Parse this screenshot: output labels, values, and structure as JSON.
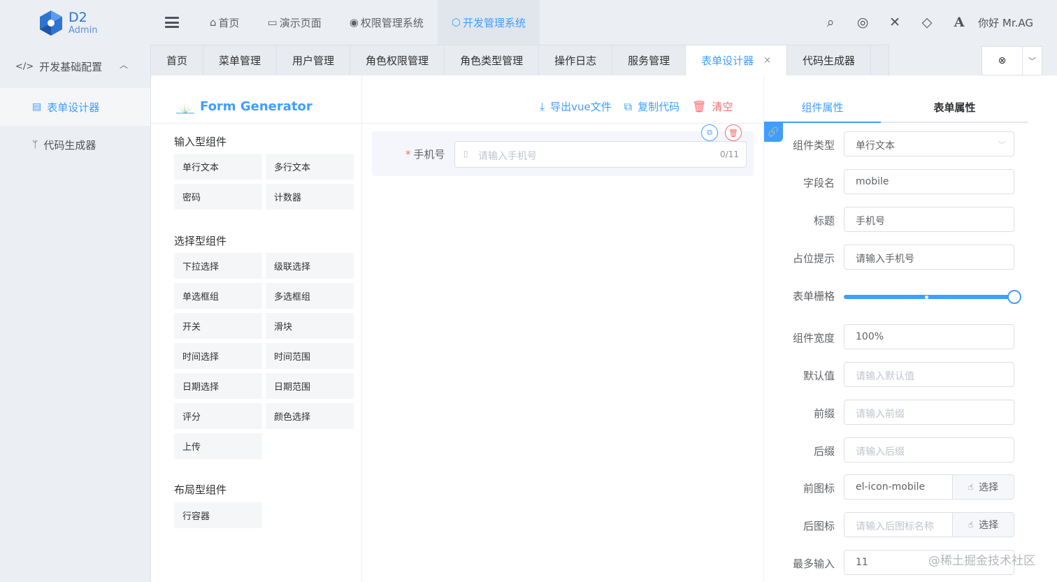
{
  "app": {
    "logo_title": "D2",
    "logo_subtitle": "Admin",
    "user_greeting": "你好 Mr.AG"
  },
  "top_nav": [
    {
      "label": "首页",
      "icon": "home-icon"
    },
    {
      "label": "演示页面",
      "icon": "folder-icon"
    },
    {
      "label": "权限管理系统",
      "icon": "chrome-icon"
    },
    {
      "label": "开发管理系统",
      "icon": "hexagon-icon",
      "active": true
    }
  ],
  "top_icons": [
    "search-icon",
    "record-icon",
    "fullscreen-icon",
    "diamond-icon",
    "font-size-icon"
  ],
  "sidebar": {
    "group_label": "开发基础配置",
    "items": [
      {
        "label": "表单设计器",
        "icon": "form-icon",
        "active": true
      },
      {
        "label": "代码生成器",
        "icon": "branch-icon"
      }
    ]
  },
  "tabs": [
    {
      "label": "首页"
    },
    {
      "label": "菜单管理"
    },
    {
      "label": "用户管理"
    },
    {
      "label": "角色权限管理"
    },
    {
      "label": "角色类型管理"
    },
    {
      "label": "操作日志"
    },
    {
      "label": "服务管理"
    },
    {
      "label": "表单设计器",
      "active": true,
      "closable": true
    },
    {
      "label": "代码生成器"
    }
  ],
  "generator": {
    "title": "Form Generator",
    "actions": {
      "export": "导出vue文件",
      "copy": "复制代码",
      "clear": "清空"
    }
  },
  "components": {
    "input_title": "输入型组件",
    "input_items": [
      "单行文本",
      "多行文本",
      "密码",
      "计数器"
    ],
    "select_title": "选择型组件",
    "select_items": [
      "下拉选择",
      "级联选择",
      "单选框组",
      "多选框组",
      "开关",
      "滑块",
      "时间选择",
      "时间范围",
      "日期选择",
      "日期范围",
      "评分",
      "颜色选择",
      "上传"
    ],
    "layout_title": "布局型组件",
    "layout_items": [
      "行容器"
    ]
  },
  "canvas": {
    "field_label": "手机号",
    "placeholder": "请输入手机号",
    "counter": "0/11"
  },
  "props_panel": {
    "tab_component": "组件属性",
    "tab_form": "表单属性",
    "component_type_label": "组件类型",
    "component_type_value": "单行文本",
    "field_name_label": "字段名",
    "field_name_value": "mobile",
    "title_label": "标题",
    "title_value": "手机号",
    "placeholder_label": "占位提示",
    "placeholder_value": "请输入手机号",
    "span_label": "表单栅格",
    "span_fraction": 1.0,
    "width_label": "组件宽度",
    "width_value": "100%",
    "default_label": "默认值",
    "default_placeholder": "请输入默认值",
    "prefix_label": "前缀",
    "prefix_placeholder": "请输入前缀",
    "suffix_label": "后缀",
    "suffix_placeholder": "请输入后缀",
    "prefix_icon_label": "前图标",
    "prefix_icon_value": "el-icon-mobile",
    "suffix_icon_label": "后图标",
    "suffix_icon_placeholder": "请输入后图标名称",
    "select_button": "选择",
    "maxlength_label": "最多输入",
    "maxlength_value": "11"
  },
  "watermark": "@稀土掘金技术社区",
  "colors": {
    "accent": "#409eff",
    "danger": "#f56c6c",
    "logo": "#2f74d0"
  }
}
